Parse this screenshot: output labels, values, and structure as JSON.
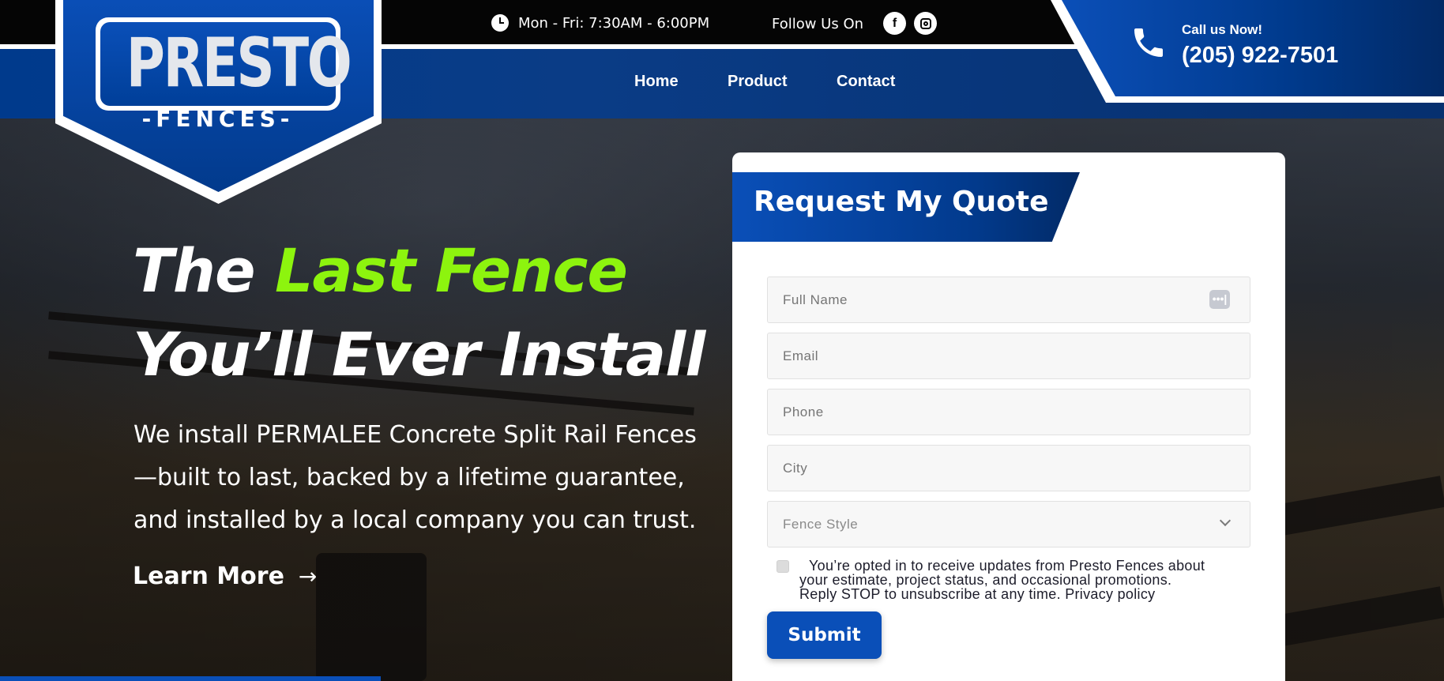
{
  "header": {
    "hours": "Mon - Fri: 7:30AM - 6:00PM",
    "follow_label": "Follow Us On",
    "social": {
      "facebook": "f"
    },
    "call_label": "Call us Now!",
    "call_number": "(205) 922-7501"
  },
  "logo": {
    "word": "PRESTO",
    "sub": "-FENCES-"
  },
  "nav": {
    "home": "Home",
    "product": "Product",
    "contact": "Contact"
  },
  "hero": {
    "headline_part1": "The ",
    "headline_accent": "Last Fence",
    "headline_line2": "You’ll Ever Install",
    "subtext": "We install PERMALEE Concrete Split Rail Fences—built to last, backed by a lifetime guarantee, and installed by a local company you can trust.",
    "learn_more": "Learn More",
    "arrow": "→"
  },
  "form": {
    "title": "Request My Quote",
    "full_name_placeholder": "Full Name",
    "email_placeholder": "Email",
    "phone_placeholder": "Phone",
    "city_placeholder": "City",
    "fence_style_placeholder": "Fence Style",
    "autofill_icon": "•••|",
    "optin_line1": "You’re opted in to receive updates from Presto Fences about",
    "optin_line2": "your estimate, project status, and occasional promotions.",
    "optin_line3": "Reply STOP to unsubscribe at any time. Privacy policy",
    "submit_label": "Submit"
  },
  "colors": {
    "brand_blue": "#0a4fb8",
    "accent_green": "#8df40e",
    "dark_blue": "#023a8c"
  }
}
